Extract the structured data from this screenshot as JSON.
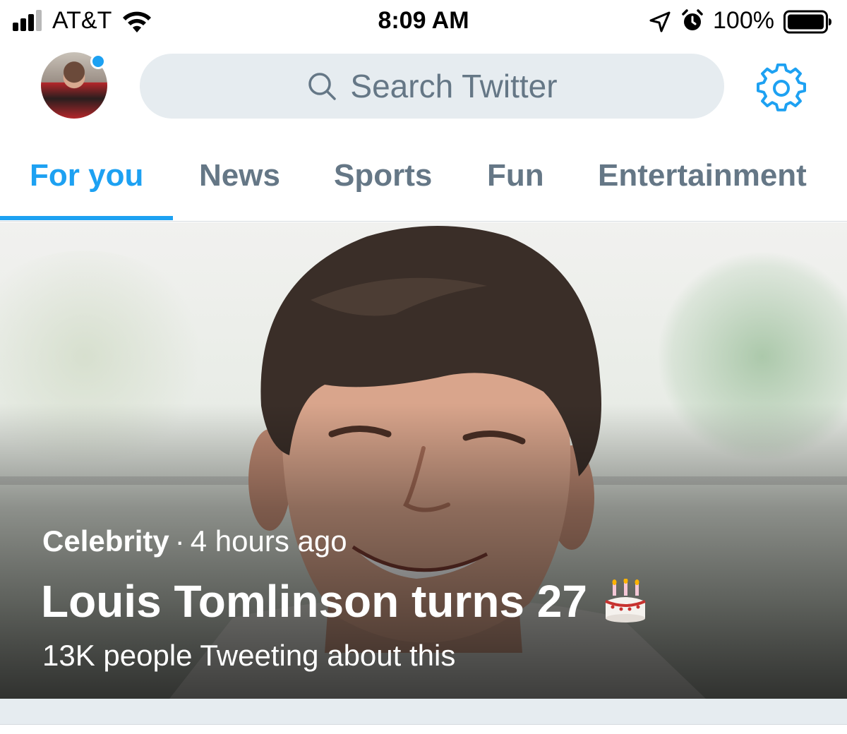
{
  "status_bar": {
    "carrier": "AT&T",
    "time": "8:09 AM",
    "battery_percent": "100%",
    "signal_bars": 4,
    "signal_bars_filled": 3
  },
  "header": {
    "search_placeholder": "Search Twitter",
    "avatar_has_notification": true
  },
  "tabs": [
    {
      "label": "For you",
      "active": true
    },
    {
      "label": "News",
      "active": false
    },
    {
      "label": "Sports",
      "active": false
    },
    {
      "label": "Fun",
      "active": false
    },
    {
      "label": "Entertainment",
      "active": false
    }
  ],
  "hero": {
    "category": "Celebrity",
    "separator": "·",
    "time_ago": "4 hours ago",
    "headline": "Louis Tomlinson turns 27",
    "headline_emoji": "birthday-cake-icon",
    "subtitle": "13K people Tweeting about this"
  },
  "colors": {
    "accent": "#1da1f2",
    "muted_text": "#657786",
    "search_bg": "#e6ecf0"
  },
  "icons": [
    "signal-icon",
    "wifi-icon",
    "location-arrow-icon",
    "alarm-icon",
    "battery-icon",
    "search-icon",
    "gear-icon",
    "birthday-cake-icon"
  ]
}
